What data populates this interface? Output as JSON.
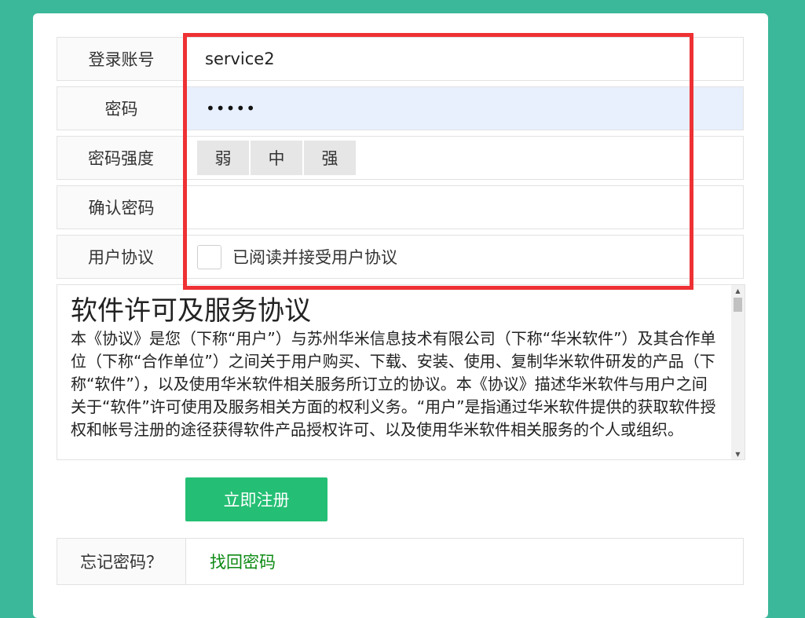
{
  "form": {
    "account_label": "登录账号",
    "account_value": "service2",
    "password_label": "密码",
    "password_dots": "•••••",
    "strength_label": "密码强度",
    "strength_levels": [
      "弱",
      "中",
      "强"
    ],
    "confirm_label": "确认密码",
    "agreement_label": "用户协议",
    "agreement_check_text": "已阅读并接受用户协议"
  },
  "agreement": {
    "title": "软件许可及服务协议",
    "body": "本《协议》是您（下称“用户”）与苏州华米信息技术有限公司（下称“华米软件”）及其合作单位（下称“合作单位”）之间关于用户购买、下载、安装、使用、复制华米软件研发的产品（下称“软件”），以及使用华米软件相关服务所订立的协议。本《协议》描述华米软件与用户之间关于“软件”许可使用及服务相关方面的权利义务。“用户”是指通过华米软件提供的获取软件授权和帐号注册的途径获得软件产品授权许可、以及使用华米软件相关服务的个人或组织。"
  },
  "actions": {
    "register_label": "立即注册",
    "forgot_label": "忘记密码？",
    "recover_link": "找回密码"
  },
  "colors": {
    "background": "#3bb899",
    "button": "#24bf74",
    "link": "#0d8a14",
    "highlight_box": "#ee3134",
    "accent": "#f26a2e"
  }
}
